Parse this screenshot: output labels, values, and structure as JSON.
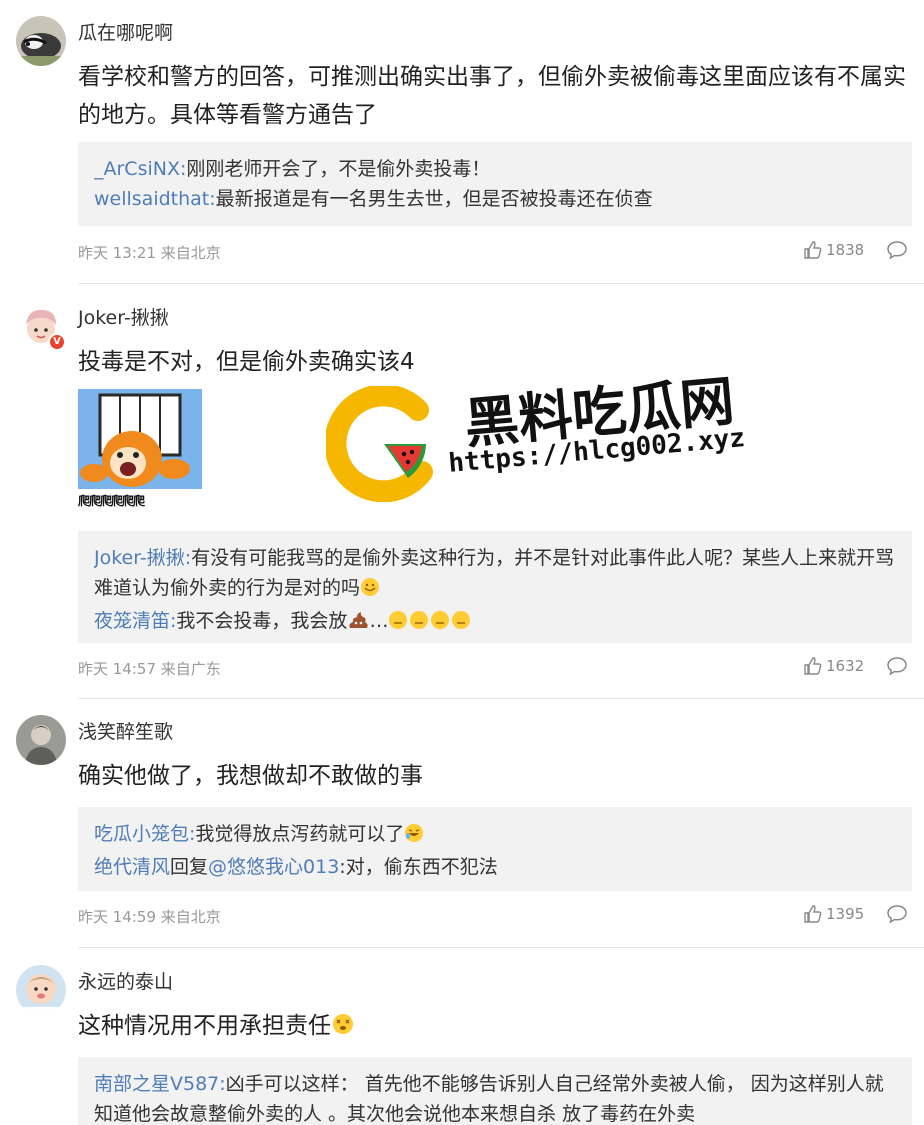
{
  "colors": {
    "reply_username": "#4f7db5",
    "reply_bg": "#f2f2f2",
    "meta_text": "#999999",
    "watermark_yellow": "#f5b700",
    "watermark_red": "#e53935"
  },
  "comments": [
    {
      "username": "瓜在哪呢啊",
      "avatar_icon": "badger-avatar",
      "text": "看学校和警方的回答，可推测出确实出事了，但偷外卖被偷毒这里面应该有不属实的地方。具体等看警方通告了",
      "replies": [
        {
          "user": "_ArCsiNX",
          "sep": ":",
          "text": "刚刚老师开会了，不是偷外卖投毒！"
        },
        {
          "user": "wellsaidthat",
          "sep": ":",
          "text": "最新报道是有一名男生去世，但是否被投毒还在侦查"
        }
      ],
      "time": "昨天 13:21 来自北京",
      "likes": "1838"
    },
    {
      "username": "Joker-揪揪",
      "avatar_icon": "cartoon-avatar",
      "verified_badge": "V",
      "text": "投毒是不对，但是偷外卖确实该4",
      "image_caption": "爬爬爬爬爬爬",
      "replies": [
        {
          "user": "Joker-揪揪",
          "sep": ":",
          "text": "有没有可能我骂的是偷外卖这种行为，并不是针对此事件此人呢？某些人上来就开骂难道认为偷外卖的行为是对的吗"
        },
        {
          "user": "夜笼清笛",
          "sep": ":",
          "text": "我不会投毒，我会放",
          "suffix": "…"
        }
      ],
      "time": "昨天 14:57 来自广东",
      "likes": "1632"
    },
    {
      "username": "浅笑醉笙歌",
      "avatar_icon": "gray-avatar",
      "text": "确实他做了，我想做却不敢做的事",
      "replies": [
        {
          "user": "吃瓜小笼包",
          "sep": ":",
          "text": "我觉得放点泻药就可以了"
        },
        {
          "user": "绝代清风",
          "mid": "回复",
          "mention": "@悠悠我心013",
          "sep": ":",
          "text": "对，偷东西不犯法"
        }
      ],
      "time": "昨天 14:59 来自北京",
      "likes": "1395"
    },
    {
      "username": "永远的泰山",
      "avatar_icon": "baby-avatar",
      "text": "这种情况用不用承担责任",
      "replies": [
        {
          "user": "南部之星V587",
          "sep": ":",
          "text": "凶手可以这样： 首先他不能够告诉别人自己经常外卖被人偷， 因为这样别人就知道他会故意整偷外卖的人 。其次他会说他本来想自杀 放了毒药在外卖"
        }
      ]
    }
  ],
  "watermark": {
    "title": "黑料吃瓜网",
    "url": "https://hlcg002.xyz",
    "logo_icon": "watermelon-c-logo-icon"
  }
}
